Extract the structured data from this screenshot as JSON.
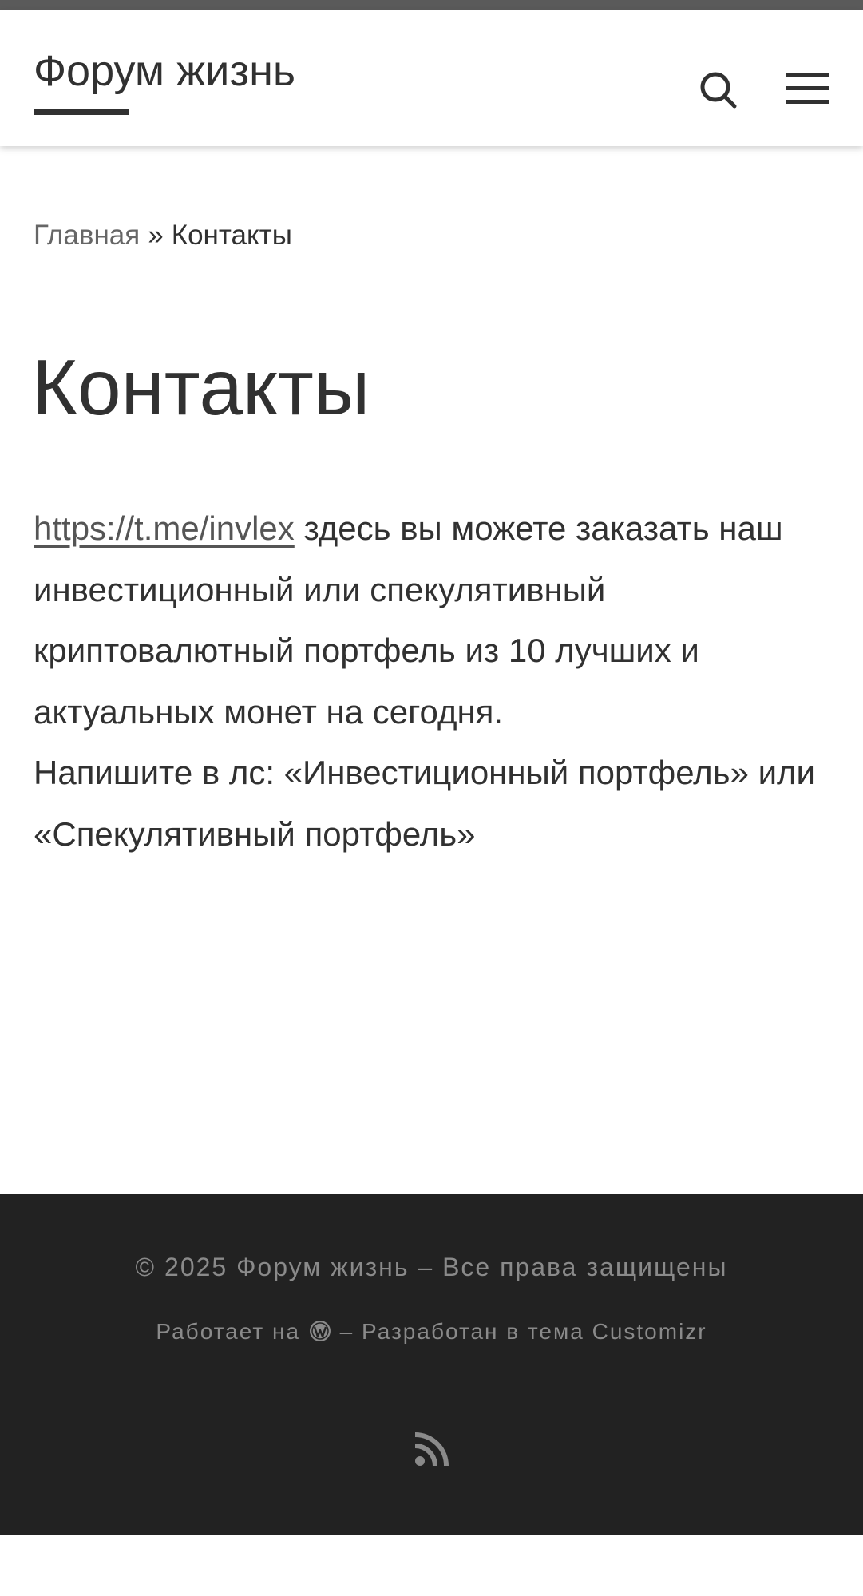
{
  "header": {
    "site_title": "Форум жизнь",
    "search_icon": "search-icon",
    "menu_icon": "hamburger-menu-icon"
  },
  "breadcrumb": {
    "home": "Главная",
    "separator": "»",
    "current": "Контакты"
  },
  "page": {
    "title": "Контакты",
    "link": "https://t.me/invlex",
    "text_after_link": " здесь вы можете заказать наш инвестиционный или спекулятивный криптовалютный портфель из 10 лучших и актуальных монет на сегодня.",
    "second_line": "Напишите в лс: «Инвестиционный портфель» или «Спекулятивный портфель»"
  },
  "footer": {
    "copyright": "© 2025 Форум жизнь – Все права защищены",
    "powered_by": "Работает на",
    "designed_by": "– Разработан в тема Customizr",
    "wordpress_icon": "wordpress-icon",
    "rss_icon": "rss-icon"
  },
  "colors": {
    "text": "#313131",
    "footer_bg": "#222222",
    "footer_text": "#8a8a8a",
    "top_bar": "#5a5a5a"
  }
}
